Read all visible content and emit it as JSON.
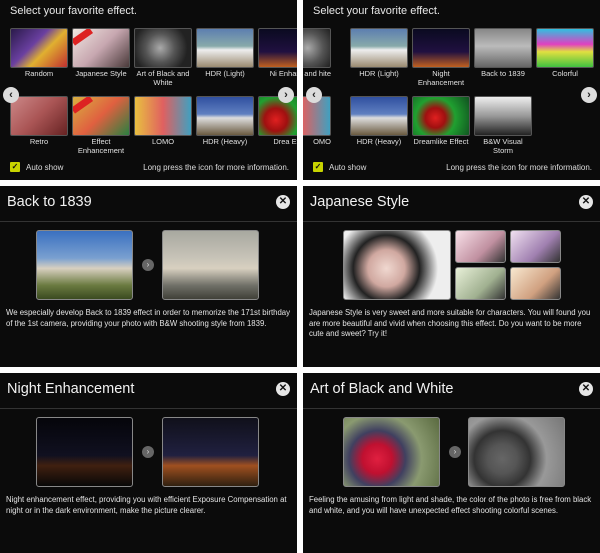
{
  "selector_left": {
    "title": "Select your favorite effect.",
    "row1": [
      "Random",
      "Japanese Style",
      "Art of Black and White",
      "HDR (Light)",
      "Ni Enhanc"
    ],
    "row2": [
      "Retro",
      "Effect Enhancement",
      "LOMO",
      "HDR (Heavy)",
      "Drea Eff"
    ],
    "auto_show": "Auto show",
    "hint": "Long press the icon for more information."
  },
  "selector_right": {
    "title": "Select your favorite effect.",
    "row1": [
      "Black and hite",
      "HDR (Light)",
      "Night Enhancement",
      "Back to 1839",
      "Colorful"
    ],
    "row2": [
      "OMO",
      "HDR (Heavy)",
      "Dreamlike Effect",
      "B&W Visual Storm"
    ],
    "auto_show": "Auto show",
    "hint": "Long press the icon for more information."
  },
  "details": [
    {
      "title": "Back to 1839",
      "desc": "We especially develop Back to 1839 effect in order to memorize the 171st birthday of the 1st camera, providing your photo with B&W shooting style from 1839."
    },
    {
      "title": "Japanese Style",
      "desc": "Japanese Style is very sweet and more suitable for characters. You will found you are more beautiful and vivid when choosing this effect. Do you want to be more cute and sweet? Try it!"
    },
    {
      "title": "Night Enhancement",
      "desc": "Night enhancement effect, providing you with efficient Exposure Compensation at night or in the dark environment, make the picture clearer."
    },
    {
      "title": "Art of Black and White",
      "desc": "Feeling the amusing from light and shade, the color of the photo is free from black and white, and you will have unexpected effect shooting colorful scenes."
    }
  ],
  "colors": {
    "panel_bg": "#0b0b0b",
    "check_color": "#c8d400"
  }
}
